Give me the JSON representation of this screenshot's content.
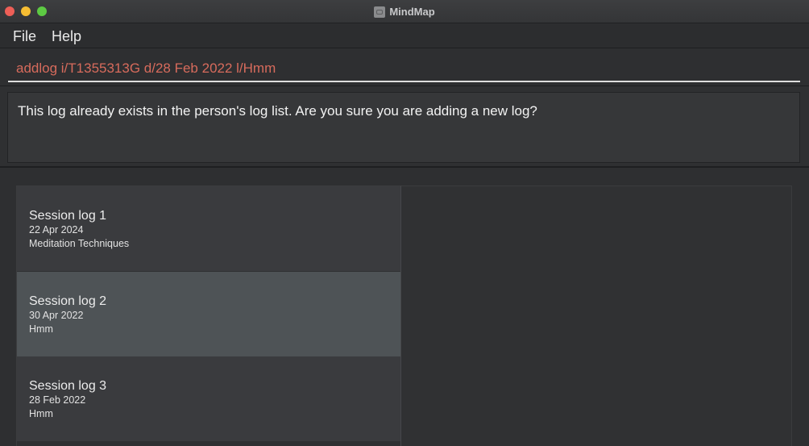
{
  "window": {
    "title": "MindMap"
  },
  "menu": {
    "file": "File",
    "help": "Help"
  },
  "command": {
    "value": "addlog i/T1355313G d/28 Feb 2022 l/Hmm"
  },
  "result": {
    "message": "This log already exists in the person's log list. Are you sure you are adding a new log?"
  },
  "logs": [
    {
      "title": "Session log 1",
      "date": "22 Apr 2024",
      "description": "Meditation Techniques",
      "selected": false
    },
    {
      "title": "Session log 2",
      "date": "30 Apr 2022",
      "description": "Hmm",
      "selected": true
    },
    {
      "title": "Session log 3",
      "date": "28 Feb 2022",
      "description": "Hmm",
      "selected": false
    }
  ],
  "colors": {
    "command_text": "#d76b5c",
    "selected_card": "#4e5356",
    "card": "#3a3b3e"
  },
  "icons": {
    "app": "app-icon"
  }
}
